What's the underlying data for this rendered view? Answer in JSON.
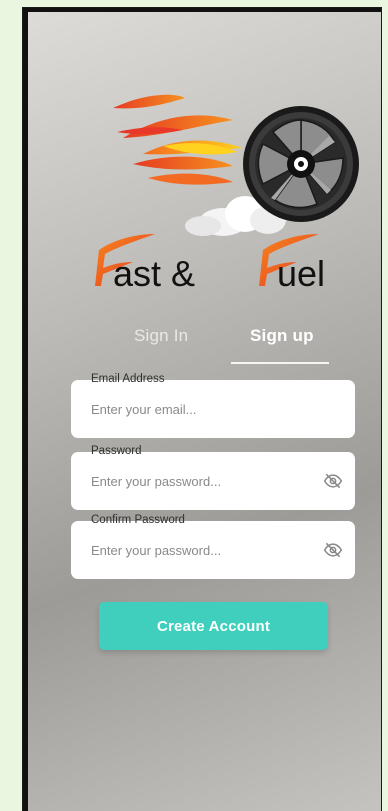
{
  "brand": {
    "name_part1": "ast &",
    "name_part2": "uel",
    "logo_icon": "flaming-wheel-icon"
  },
  "tabs": {
    "signin_label": "Sign In",
    "signup_label": "Sign up",
    "active": "Sign up"
  },
  "form": {
    "email": {
      "label": "Email Address",
      "placeholder": "Enter your email...",
      "value": ""
    },
    "password": {
      "label": "Password",
      "placeholder": "Enter your password...",
      "value": "",
      "toggle_icon": "eye-off-icon"
    },
    "confirm_password": {
      "label": "Confirm Password",
      "placeholder": "Enter your password...",
      "value": "",
      "toggle_icon": "eye-off-icon"
    }
  },
  "actions": {
    "create_label": "Create Account"
  },
  "colors": {
    "accent": "#3fcfbc",
    "flame_red": "#e8382a",
    "flame_orange": "#f7861f",
    "flame_yellow": "#ffd21f",
    "wheel_dark": "#1a1a1a"
  }
}
